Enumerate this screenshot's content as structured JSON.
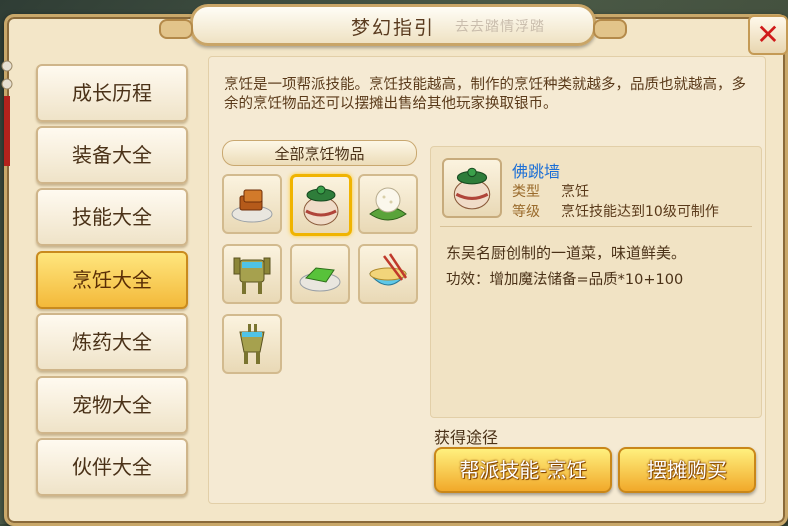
{
  "window": {
    "title": "梦幻指引",
    "title_decoration": "去去踏情浮踏"
  },
  "sidebar": {
    "items": [
      {
        "label": "成长历程",
        "active": false
      },
      {
        "label": "装备大全",
        "active": false
      },
      {
        "label": "技能大全",
        "active": false
      },
      {
        "label": "烹饪大全",
        "active": true
      },
      {
        "label": "炼药大全",
        "active": false
      },
      {
        "label": "宠物大全",
        "active": false
      },
      {
        "label": "伙伴大全",
        "active": false
      }
    ]
  },
  "main": {
    "description": "烹饪是一项帮派技能。烹饪技能越高，制作的烹饪种类就越多，品质也就越高，多余的烹饪物品还可以摆摊出售给其他玩家换取银币。",
    "category_label": "全部烹饪物品",
    "items": [
      {
        "icon": "braised-tofu-icon",
        "selected": false
      },
      {
        "icon": "jar-dish-icon",
        "selected": true
      },
      {
        "icon": "rice-ball-icon",
        "selected": false
      },
      {
        "icon": "bronze-vessel-icon",
        "selected": false
      },
      {
        "icon": "green-cake-icon",
        "selected": false
      },
      {
        "icon": "noodle-bowl-icon",
        "selected": false
      },
      {
        "icon": "bronze-cup-icon",
        "selected": false
      }
    ],
    "detail": {
      "name": "佛跳墙",
      "type_label": "类型",
      "type_value": "烹饪",
      "level_label": "等级",
      "level_value": "烹饪技能达到10级可制作",
      "flavor": "东吴名厨创制的一道菜，味道鲜美。",
      "effect": "功效：增加魔法储备=品质*10+100"
    },
    "source_label": "获得途径",
    "buttons": {
      "guild_skill": "帮派技能-烹饪",
      "stall_buy": "摆摊购买"
    }
  },
  "colors": {
    "accent": "#f3b93a",
    "frame": "#c9a86a",
    "name": "#1c6fd6",
    "close": "#d01a1a"
  }
}
